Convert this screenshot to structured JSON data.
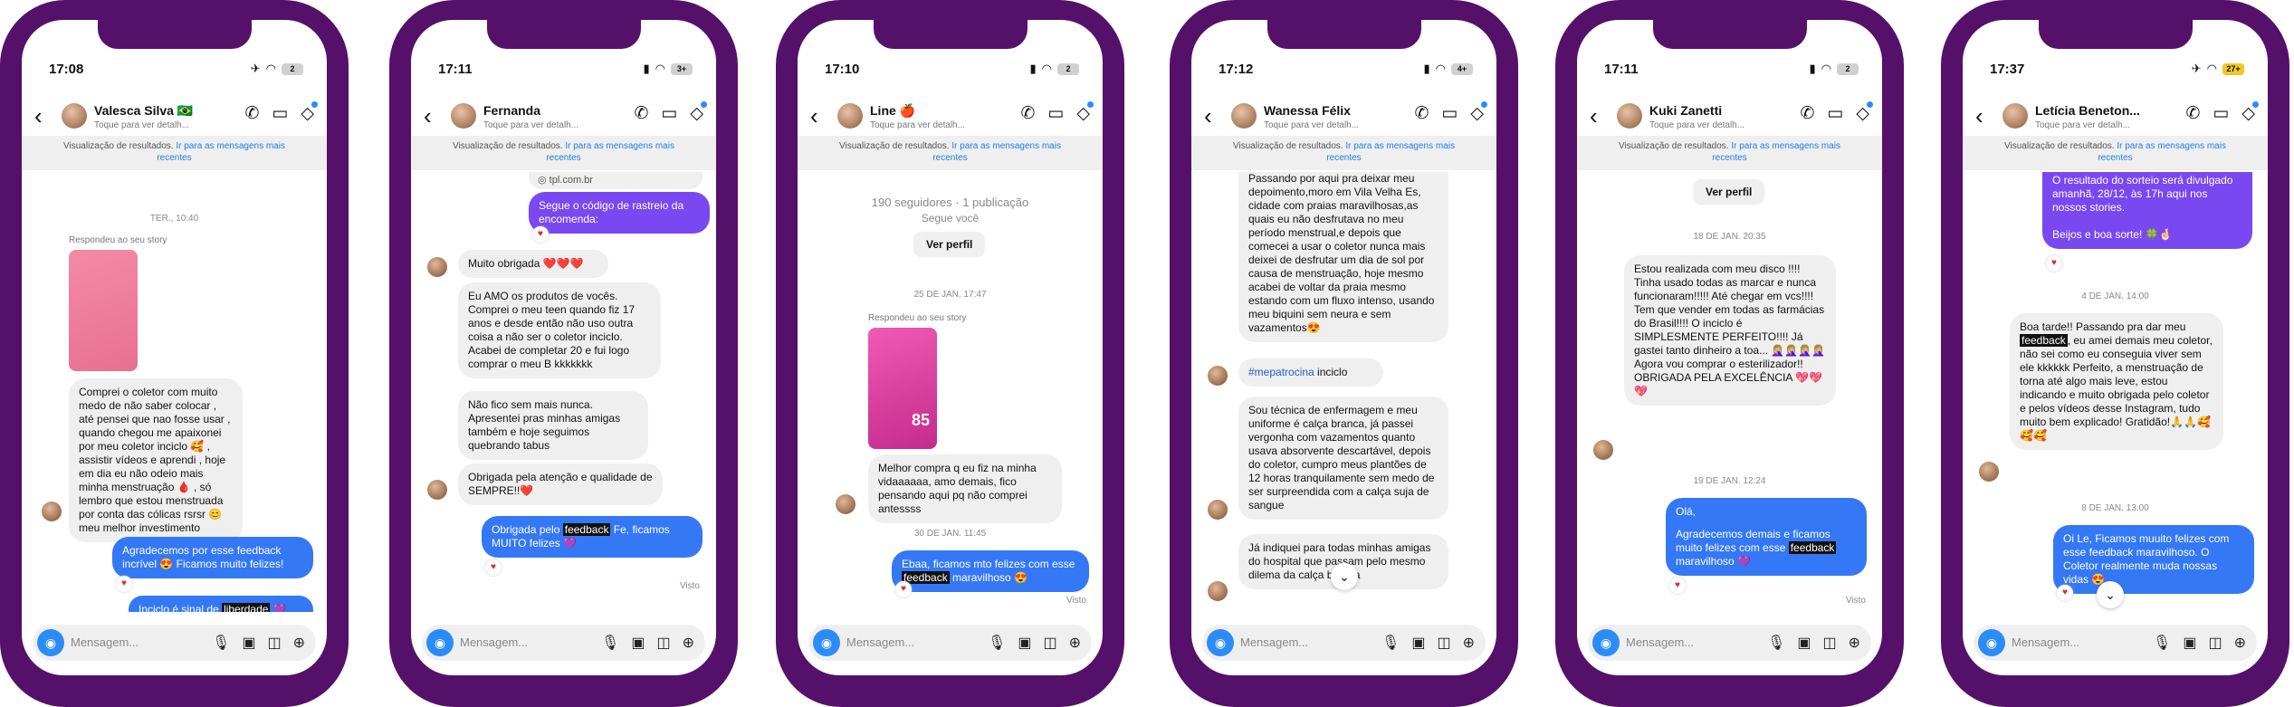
{
  "composer": {
    "placeholder": "Mensagem..."
  },
  "banner": {
    "text": "Visualização de resultados. ",
    "link": "Ir para as mensagens mais recentes"
  },
  "phones": [
    {
      "time": "17:08",
      "battery": "2",
      "name": "Valesca Silva 🇧🇷",
      "sub": "Toque para ver detalh...",
      "stamp1": "TER., 10:40",
      "replied": "Respondeu ao seu story",
      "m1": "Comprei o coletor com muito medo de não saber colocar , até pensei que nao fosse usar , quando chegou me apaixonei por meu coletor inciclo 🥰 , assistir vídeos e aprendi , hoje em dia eu não odeio mais minha menstruação 🩸 , só lembro que estou menstruada por conta das cólicas rsrsr 😊 meu melhor investimento",
      "m2": "Agradecemos por esse feedback incrível 😍 Ficamos muito felizes!",
      "m3a": "Inciclo é sinal de ",
      "m3b": "liberdade",
      "m3c": " 💜"
    },
    {
      "time": "17:11",
      "battery": "3+",
      "name": "Fernanda",
      "sub": "Toque para ver detalh...",
      "link": "tpl.com.br",
      "m0": "Segue o código de rastreio da encomenda:",
      "m1": "Muito obrigada ❤️❤️❤️",
      "m2": "Eu AMO os produtos de vocês. Comprei o meu teen quando fiz 17 anos e desde então não uso outra coisa a não ser o coletor inciclo. Acabei de completar 20 e fui logo comprar o meu B kkkkkkk",
      "m3": "Não fico sem mais nunca. Apresentei pras minhas amigas também e hoje seguimos quebrando tabus",
      "m4": "Obrigada pela atenção e qualidade de SEMPRE!!❤️",
      "m5a": "Obrigada pelo ",
      "m5b": "feedback",
      "m5c": " Fe, ficamos MUITO felizes 💜",
      "seen": "Visto"
    },
    {
      "time": "17:10",
      "battery": "2",
      "name": "Line 🍎",
      "sub": "Toque para ver detalh...",
      "followers": "190 seguidores · 1 publicação",
      "follows": "Segue você",
      "profile_btn": "Ver perfil",
      "stamp1": "25 DE JAN. 17:47",
      "replied": "Respondeu ao seu story",
      "story_price": "85",
      "m1": "Melhor compra q eu fiz na minha vidaaaaaa, amo demais, fico pensando aqui pq não comprei antessss",
      "stamp2": "30 DE JAN. 11:45",
      "m2a": "Ebaa, ficamos mto felizes com esse ",
      "m2b": "feedback",
      "m2c": " maravilhoso 😍",
      "seen": "Visto"
    },
    {
      "time": "17:12",
      "battery": "4+",
      "name": "Wanessa Félix",
      "sub": "Toque para ver detalh...",
      "m1": "Passando por aqui pra deixar meu depoimento,moro em Vila Velha Es, cidade com praias maravilhosas,as quais eu não desfrutava no meu período menstrual,e depois que comecei a usar o coletor nunca mais deixei de desfrutar um dia de sol por causa de menstruação, hoje mesmo acabei de voltar da praia mesmo estando com um fluxo intenso, usando meu biquini sem neura e sem vazamentos😍",
      "m2a": "#mepatrocina",
      "m2b": " inciclo",
      "m3": "Sou técnica de enfermagem e meu uniforme é calça branca, já passei vergonha com vazamentos quanto usava absorvente descartável, depois do coletor, cumpro meus plantões de 12 horas tranquilamente sem medo de ser surpreendida com a calça suja de sangue",
      "m4": "Já indiquei para todas minhas amigas do hospital que passam pelo mesmo dilema da calça branca"
    },
    {
      "time": "17:11",
      "battery": "2",
      "name": "Kuki Zanetti",
      "sub": "Toque para ver detalh...",
      "profile_btn": "Ver perfil",
      "stamp1": "18 DE JAN. 20:35",
      "m1": "Estou realizada com meu disco !!!! Tinha usado todas as marcar e nunca funcionaram!!!!! Até chegar em vcs!!!! Tem que vender em todas as farmácias do Brasil!!!! O inciclo é SIMPLESMENTE PERFEITO!!!! Já gastei tanto dinheiro a toa... 🤦🏼‍♀️🤦🏼‍♀️🤦🏼‍♀️🤦🏼‍♀️ Agora vou comprar o esterilizador!! OBRIGADA PELA EXCELÊNCIA 💖💖💖",
      "stamp2": "19 DE JAN. 12:24",
      "m2a": "Olá,",
      "m2b": "Agradecemos demais e ficamos muito felizes com esse ",
      "m2c": "feedback",
      "m2d": " maravilhoso 💜",
      "seen": "Visto"
    },
    {
      "time": "17:37",
      "battery": "27+",
      "name": "Letícia Beneton...",
      "sub": "Toque para ver detalh...",
      "m0": "O resultado do sorteio será divulgado amanhã, 28/12, às 17h aqui nos nossos stories.\n\nBeijos e boa sorte! 🍀🤞🏻",
      "stamp1": "4 DE JAN. 14:00",
      "m1a": "Boa tarde!! Passando pra dar meu ",
      "m1b": "feedback",
      "m1c": ", eu amei demais meu coletor, não sei como eu conseguia viver sem ele kkkkkk Perfeito, a menstruação de torna até algo mais leve, estou indicando e muito obrigada pelo coletor e pelos vídeos desse Instagram, tudo muito bem explicado! Gratidão!🙏🙏🥰🥰🥰",
      "stamp2": "8 DE JAN. 13:00",
      "m2": "Oi Le, Ficamos muuito felizes com esse feedback maravilhoso. O Coletor realmente muda nossas vidas 😍"
    }
  ]
}
